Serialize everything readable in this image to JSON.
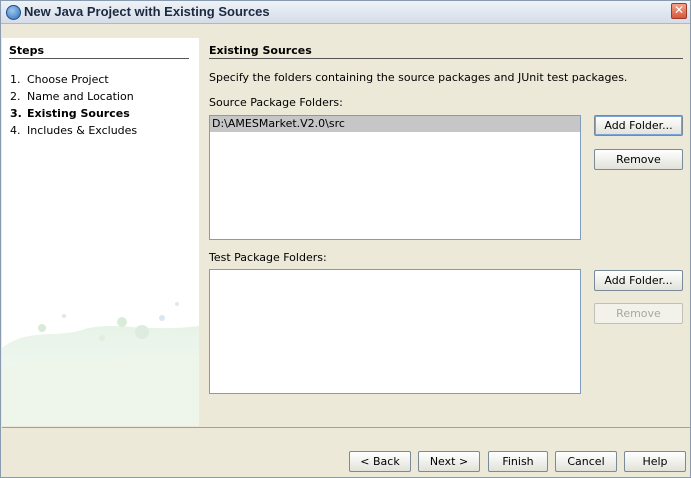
{
  "window": {
    "title": "New Java Project with Existing Sources",
    "close_glyph": "✕"
  },
  "steps": {
    "title": "Steps",
    "items": [
      {
        "num": "1.",
        "label": "Choose Project"
      },
      {
        "num": "2.",
        "label": "Name and Location"
      },
      {
        "num": "3.",
        "label": "Existing Sources"
      },
      {
        "num": "4.",
        "label": "Includes & Excludes"
      }
    ],
    "current_index": 2
  },
  "panel": {
    "title": "Existing Sources",
    "description": "Specify the folders containing the source packages and JUnit test packages.",
    "source_label": "Source Package Folders:",
    "source_items": [
      "D:\\AMESMarket.V2.0\\src"
    ],
    "test_label": "Test Package Folders:",
    "test_items": []
  },
  "buttons": {
    "source_add": "Add Folder...",
    "source_remove": "Remove",
    "test_add": "Add Folder...",
    "test_remove": "Remove",
    "back": "< Back",
    "next": "Next >",
    "finish": "Finish",
    "cancel": "Cancel",
    "help": "Help"
  },
  "colors": {
    "accent": "#2d6fb8",
    "selection": "#c6c6c6",
    "dialog_bg": "#ece9d8"
  },
  "icons": {
    "app": "java-project-icon",
    "close": "close-icon"
  }
}
